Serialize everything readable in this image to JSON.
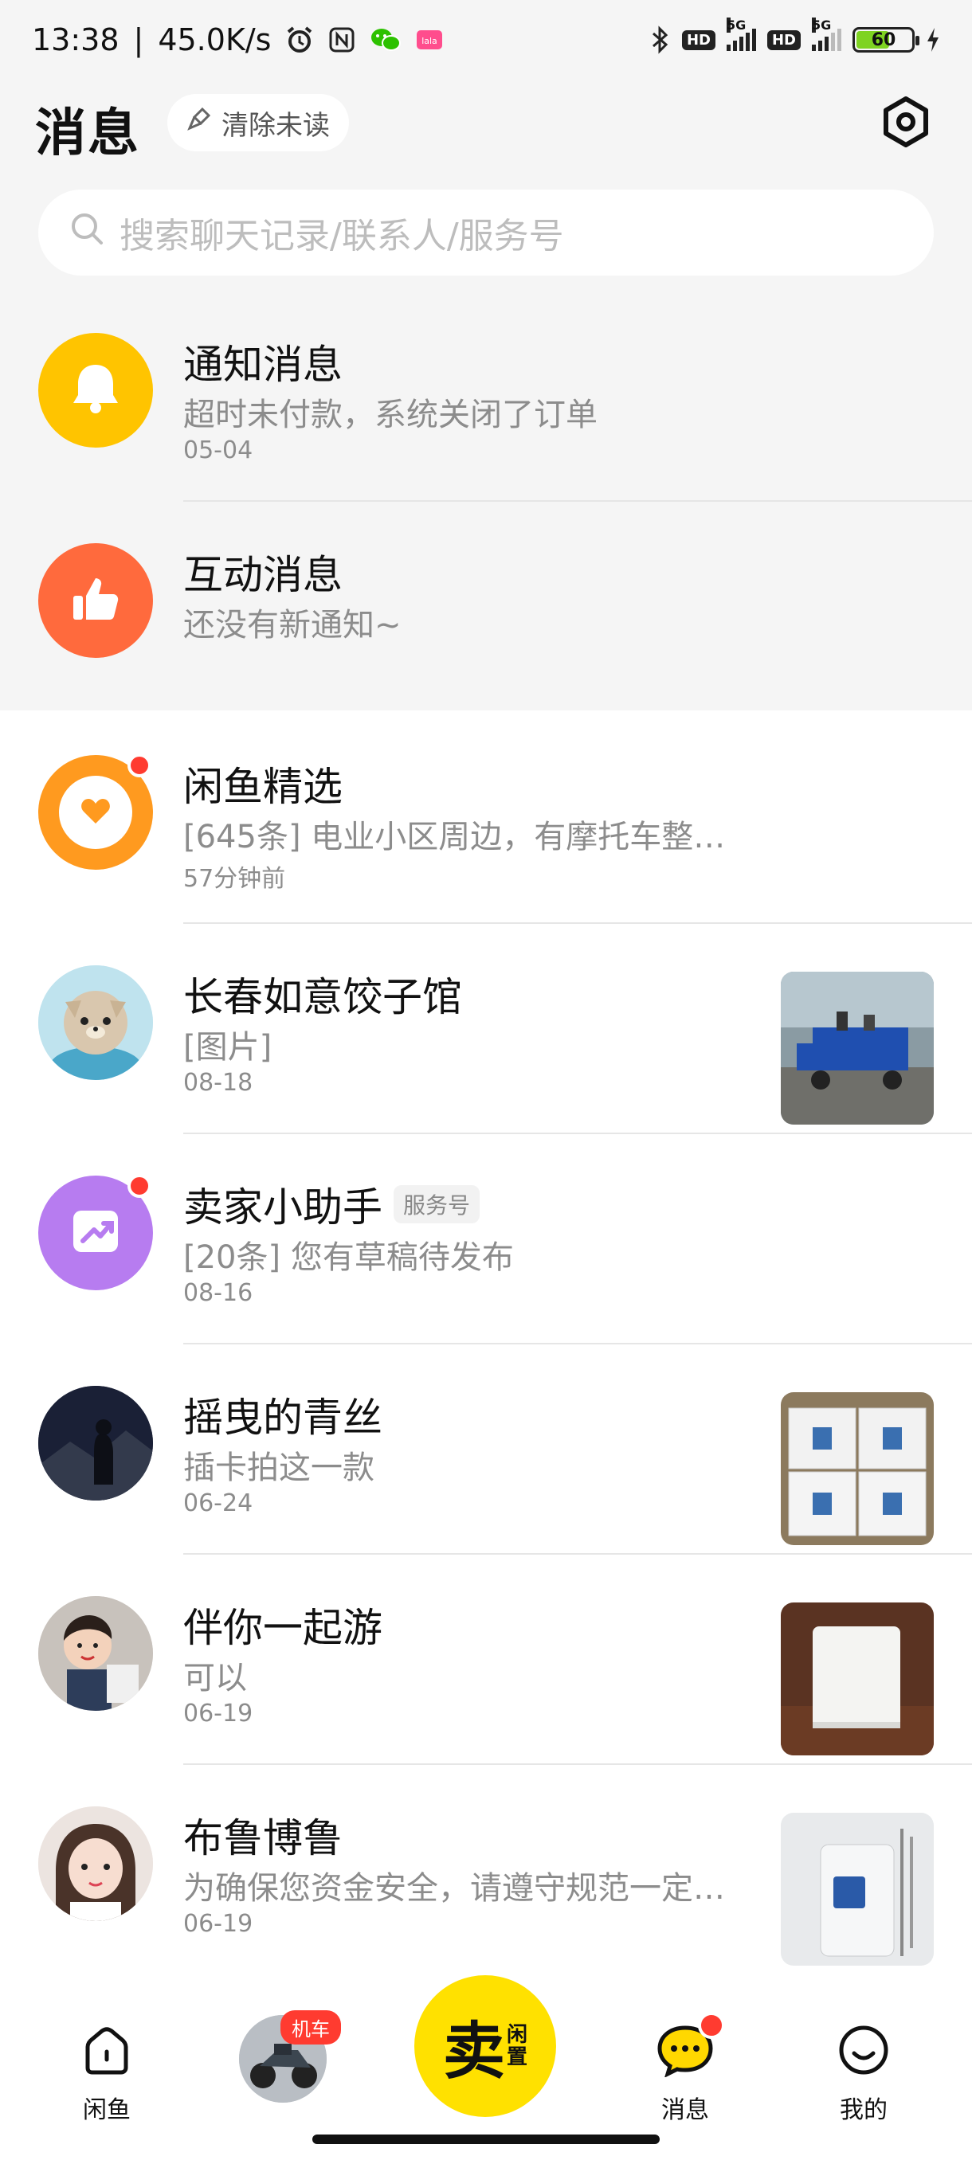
{
  "status_bar": {
    "time": "13:38",
    "net_speed": "45.0K/s",
    "battery_level": "60",
    "battery_fraction": 0.6,
    "signal_label": "5G",
    "hd_label": "HD"
  },
  "header": {
    "title": "消息",
    "clear_unread_label": "清除未读"
  },
  "search": {
    "placeholder": "搜索聊天记录/联系人/服务号"
  },
  "system_rows": [
    {
      "title": "通知消息",
      "preview": "超时未付款，系统关闭了订单",
      "time": "05-04",
      "icon": "bell-icon",
      "color": "#ffc400"
    },
    {
      "title": "互动消息",
      "preview": "还没有新通知~",
      "time": "",
      "icon": "thumbs-up-icon",
      "color": "#ff6a3d"
    }
  ],
  "chats": [
    {
      "title": "闲鱼精选",
      "preview": "[645条] 电业小区周边，有摩托车整…",
      "time": "57分钟前",
      "unread": true,
      "avatar": "heart-icon"
    },
    {
      "title": "长春如意饺子馆",
      "preview": "[图片]",
      "time": "08-18",
      "unread": false,
      "avatar": "cat-avatar",
      "thumb": "motor-tricycle-photo"
    },
    {
      "title": "卖家小助手",
      "tag": "服务号",
      "preview": "[20条] 您有草稿待发布",
      "time": "08-16",
      "unread": true,
      "avatar": "trend-up-icon"
    },
    {
      "title": "摇曳的青丝",
      "preview": "插卡拍这一款",
      "time": "06-24",
      "unread": false,
      "avatar": "night-photo-avatar",
      "thumb": "boxes-photo"
    },
    {
      "title": "伴你一起游",
      "preview": "可以",
      "time": "06-19",
      "unread": false,
      "avatar": "kid-photo-avatar",
      "thumb": "router-photo"
    },
    {
      "title": "布鲁博鲁",
      "preview": "为确保您资金安全，请遵守规范一定…",
      "time": "06-19",
      "unread": false,
      "avatar": "girl-photo-avatar",
      "thumb": "device-photo"
    }
  ],
  "tabbar": {
    "home_label": "闲鱼",
    "moto_badge": "机车",
    "sell_main": "卖",
    "sell_sub_1": "闲",
    "sell_sub_2": "置",
    "messages_label": "消息",
    "me_label": "我的"
  }
}
